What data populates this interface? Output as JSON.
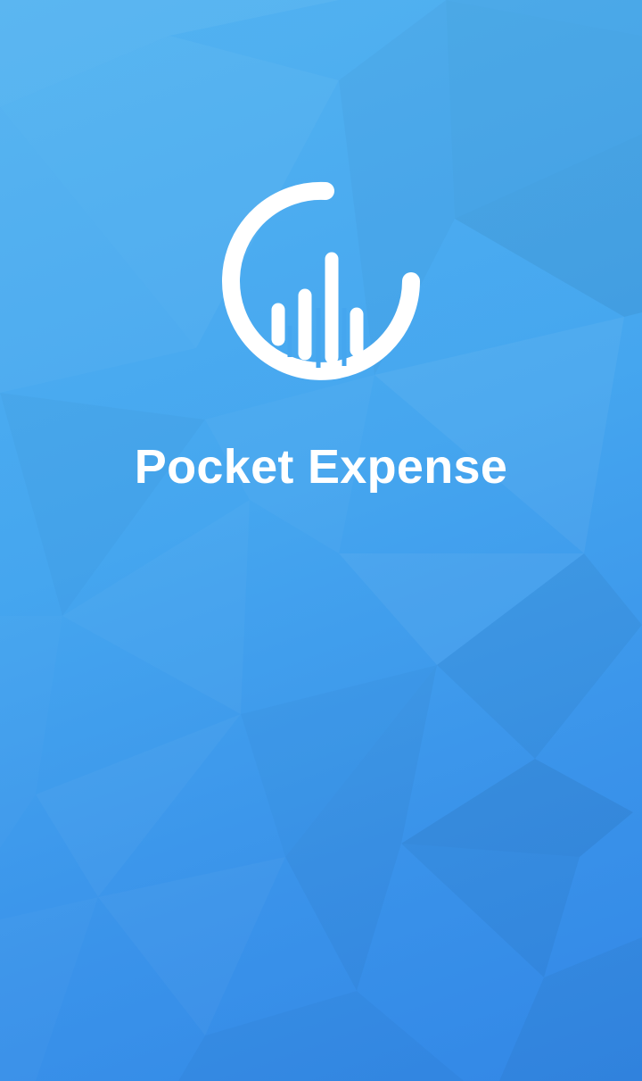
{
  "app": {
    "name": "Pocket Expense"
  },
  "logo": {
    "icon": "pocket-expense-logo-icon",
    "color": "#ffffff"
  },
  "theme": {
    "background_top": "#53b3f1",
    "background_bottom": "#3287e6"
  }
}
